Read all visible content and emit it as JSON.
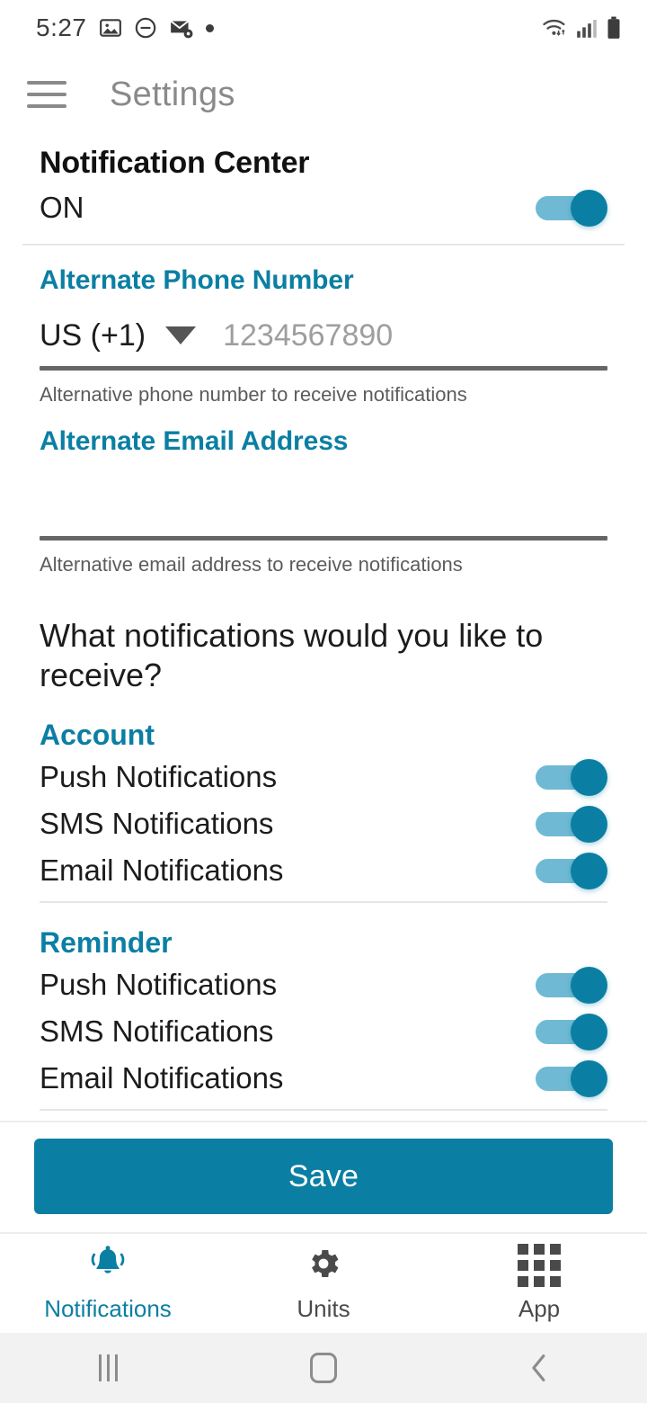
{
  "status_bar": {
    "time": "5:27",
    "left_icons": [
      "image-icon",
      "do-not-disturb-icon",
      "mail-settings-icon",
      "dot-indicator-icon"
    ],
    "right_icons": [
      "wifi-icon",
      "cellular-signal-icon",
      "battery-icon"
    ]
  },
  "app_bar": {
    "menu_icon": "hamburger-menu-icon",
    "title": "Settings"
  },
  "notification_center": {
    "heading": "Notification Center",
    "state_label": "ON",
    "enabled": true
  },
  "alternate_phone": {
    "label": "Alternate Phone Number",
    "country_code": "US (+1)",
    "dropdown_icon": "chevron-down-icon",
    "value": "",
    "placeholder": "1234567890",
    "hint": "Alternative phone number to receive notifications"
  },
  "alternate_email": {
    "label": "Alternate Email Address",
    "value": "",
    "placeholder": "",
    "hint": "Alternative email address to receive notifications"
  },
  "question": "What notifications would you like to receive?",
  "groups": [
    {
      "title": "Account",
      "rows": [
        {
          "label": "Push Notifications",
          "enabled": true
        },
        {
          "label": "SMS Notifications",
          "enabled": true
        },
        {
          "label": "Email Notifications",
          "enabled": true
        }
      ]
    },
    {
      "title": "Reminder",
      "rows": [
        {
          "label": "Push Notifications",
          "enabled": true
        },
        {
          "label": "SMS Notifications",
          "enabled": true
        },
        {
          "label": "Email Notifications",
          "enabled": true
        }
      ]
    }
  ],
  "save": {
    "label": "Save"
  },
  "bottom_nav": {
    "items": [
      {
        "label": "Notifications",
        "icon": "bell-icon",
        "active": true
      },
      {
        "label": "Units",
        "icon": "gear-icon",
        "active": false
      },
      {
        "label": "App",
        "icon": "grid-icon",
        "active": false
      }
    ]
  },
  "system_nav": {
    "recents": "recents-icon",
    "home": "home-icon",
    "back": "back-icon"
  },
  "colors": {
    "accent": "#0b7fa3",
    "toggle_track": "#6fb9d4",
    "toggle_thumb": "#0b7fa3",
    "title_gray": "#8a8a8a",
    "hint_gray": "#5c5c5c",
    "underline_gray": "#666666"
  }
}
